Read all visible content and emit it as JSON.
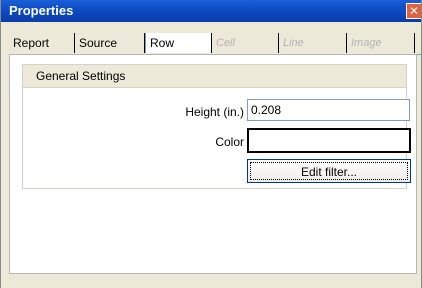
{
  "window": {
    "title": "Properties",
    "close_glyph": "✕"
  },
  "tabs": [
    {
      "label": "Report",
      "state": "normal"
    },
    {
      "label": "Source",
      "state": "normal"
    },
    {
      "label": "Row",
      "state": "active"
    },
    {
      "label": "Cell",
      "state": "disabled"
    },
    {
      "label": "Line",
      "state": "disabled"
    },
    {
      "label": "Image",
      "state": "disabled"
    }
  ],
  "group": {
    "title": "General Settings",
    "height_label": "Height (in.)",
    "height_value": "0.208",
    "color_label": "Color",
    "color_value": "",
    "edit_filter_label": "Edit filter..."
  },
  "colors": {
    "titlebar": "#0a47c0",
    "window_bg": "#ece9d8",
    "close": "#e2603c"
  }
}
